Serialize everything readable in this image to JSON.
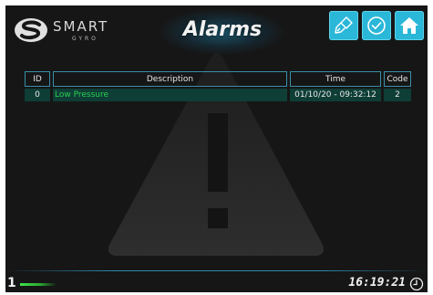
{
  "header": {
    "brand": "SMART",
    "brand_sub": "GYRO",
    "title": "Alarms"
  },
  "toolbar": {
    "buttons": [
      {
        "icon": "brush-icon",
        "action": "clear"
      },
      {
        "icon": "check-circle-icon",
        "action": "acknowledge"
      },
      {
        "icon": "home-icon",
        "action": "home"
      }
    ],
    "button_color": "#2ab7d8"
  },
  "alarm_table": {
    "columns": [
      "ID",
      "Description",
      "Time",
      "Code"
    ],
    "rows": [
      {
        "id": "0",
        "description": "Low Pressure",
        "time": "01/10/20 - 09:32:12",
        "code": "2"
      }
    ]
  },
  "watermark": {
    "icon": "warning-triangle-icon"
  },
  "footer": {
    "page": "1",
    "clock": "16:19:21",
    "clock_icon": "clock-icon"
  },
  "colors": {
    "background": "#161616",
    "accent": "#2ab7d8",
    "alarm_text": "#2ad04e",
    "row_bg": "#0e3e36"
  }
}
